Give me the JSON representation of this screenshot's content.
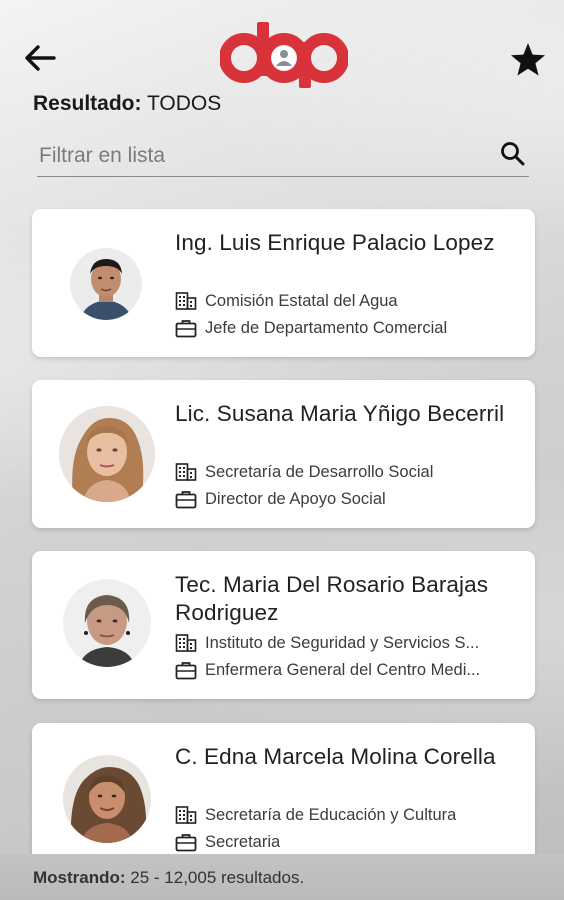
{
  "header": {
    "result_prefix": "Resultado:",
    "result_value": "TODOS",
    "logo_text": "dap"
  },
  "search": {
    "placeholder": "Filtrar en lista",
    "value": ""
  },
  "contacts": [
    {
      "name": "Ing. Luis Enrique Palacio Lopez",
      "organization": "Comisión Estatal del Agua",
      "position": "Jefe de Departamento Comercial"
    },
    {
      "name": "Lic. Susana Maria Yñigo Becerril",
      "organization": "Secretaría de Desarrollo Social",
      "position": "Director de Apoyo Social"
    },
    {
      "name": "Tec. Maria Del Rosario Barajas Rodriguez",
      "organization": "Instituto de Seguridad y Servicios S...",
      "position": "Enfermera General del Centro Medi..."
    },
    {
      "name": "C. Edna Marcela Molina Corella",
      "organization": "Secretaría de Educación y Cultura",
      "position": "Secretaria"
    }
  ],
  "footer": {
    "label": "Mostrando:",
    "value": "25 - 12,005 resultados."
  },
  "colors": {
    "brand_red": "#d8323a",
    "text_dark": "#222222"
  },
  "icons": {
    "back": "arrow-left-icon",
    "favorite": "star-icon",
    "search": "search-icon",
    "organization": "building-icon",
    "position": "briefcase-icon"
  }
}
